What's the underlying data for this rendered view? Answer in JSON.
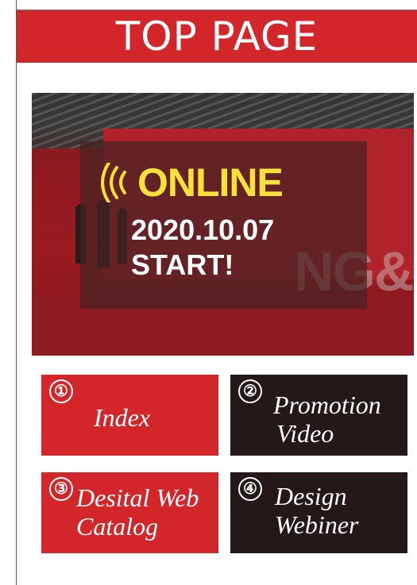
{
  "header": {
    "title": "TOP PAGE"
  },
  "hero": {
    "headline": "ONLINE",
    "date": "2020.10.07",
    "start": "START!",
    "background_text": "NG&",
    "colors": {
      "headline": "#f7e23a",
      "overlay": "#46232380"
    }
  },
  "buttons": [
    {
      "num": "①",
      "label_line1": "Index",
      "label_line2": "",
      "color": "#d2262b"
    },
    {
      "num": "②",
      "label_line1": "Promotion",
      "label_line2": "Video",
      "color": "#241818"
    },
    {
      "num": "③",
      "label_line1": "Desital Web",
      "label_line2": "Catalog",
      "color": "#d2262b"
    },
    {
      "num": "④",
      "label_line1": "Design",
      "label_line2": "Webiner",
      "color": "#241818"
    }
  ],
  "colors": {
    "brand_red": "#d2262b",
    "dark": "#241818"
  },
  "icons": {
    "broadcast": "broadcast-icon"
  }
}
